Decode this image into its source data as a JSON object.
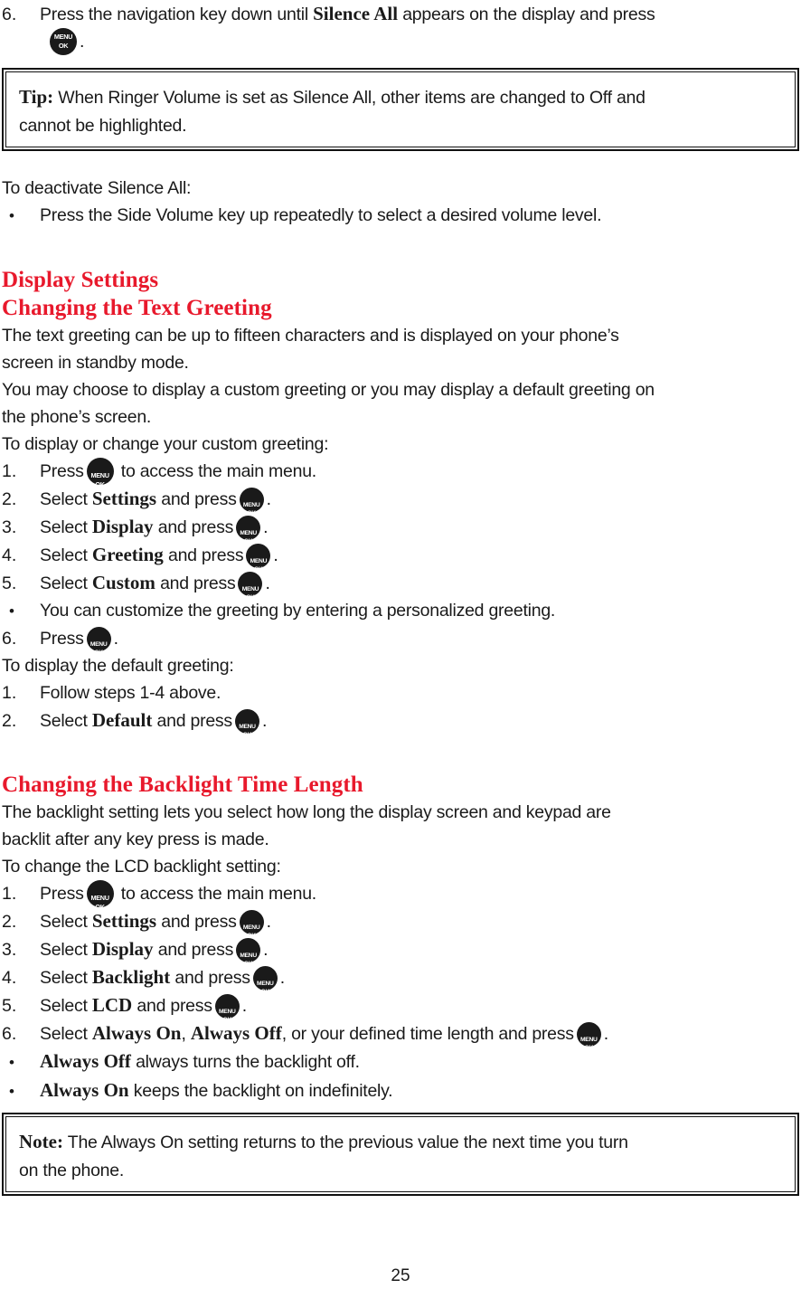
{
  "page": {
    "number": "25",
    "accent_color": "#e8192c",
    "text_color": "#1a1a1a"
  },
  "key_icon": {
    "name": "menu-ok-key",
    "line1": "MENU",
    "line2": "OK"
  },
  "silence_all_step": {
    "marker": "6.",
    "text_before_bold": "Press the navigation key down until ",
    "bold": "Silence All",
    "text_after_bold": " appears on the display and press",
    "continuation_suffix": "."
  },
  "tip_box": {
    "label": "Tip:",
    "line1": " When Ringer Volume is set as Silence All, other items are changed to Off and",
    "line2": "cannot be highlighted."
  },
  "deactivate": {
    "intro": "To deactivate Silence All:",
    "bullet_marker": "•",
    "bullet_text": "Press the Side Volume key up repeatedly to select a desired volume level."
  },
  "display_settings": {
    "section_heading": "Display Settings",
    "sub_heading": "Changing the Text Greeting",
    "paragraph_line1": "The text greeting can be up to fifteen characters and is displayed on your phone’s",
    "paragraph_line2": "screen in standby mode.",
    "paragraph_line3": "You may choose to display a custom greeting or you may display a default greeting on",
    "paragraph_line4": "the phone’s screen.",
    "custom_intro": "To display or change your custom greeting:",
    "steps": [
      {
        "marker": "1.",
        "pre": "Press",
        "bold": "",
        "post": "to access the main menu.",
        "key": "after-pre"
      },
      {
        "marker": "2.",
        "pre": "Select",
        "bold": "Settings",
        "post": "and press",
        "key": "end",
        "period": "."
      },
      {
        "marker": "3.",
        "pre": "Select",
        "bold": "Display",
        "post": "and press",
        "key": "end",
        "period": "."
      },
      {
        "marker": "4.",
        "pre": "Select",
        "bold": "Greeting",
        "post": "and press",
        "key": "end",
        "period": "."
      },
      {
        "marker": "5.",
        "pre": "Select",
        "bold": "Custom",
        "post": "and press",
        "key": "end",
        "period": "."
      }
    ],
    "customize_bullet_marker": "•",
    "customize_bullet_text": "You can customize the greeting by entering a personalized greeting.",
    "step6": {
      "marker": "6.",
      "pre": "Press",
      "period": "."
    },
    "default_intro": "To display the default greeting:",
    "default_steps": [
      {
        "marker": "1.",
        "text": "Follow steps 1-4 above."
      },
      {
        "marker": "2.",
        "pre": "Select",
        "bold": "Default",
        "post": "and press",
        "period": "."
      }
    ]
  },
  "backlight": {
    "sub_heading": "Changing the Backlight Time Length",
    "paragraph_line1": "The backlight setting lets you select how long the display screen and keypad are",
    "paragraph_line2": "backlit after any key press is made.",
    "intro": "To change the LCD backlight setting:",
    "steps": [
      {
        "marker": "1.",
        "pre": "Press",
        "bold": "",
        "post": "to access the main menu."
      },
      {
        "marker": "2.",
        "pre": "Select",
        "bold": "Settings",
        "post": "and press",
        "period": "."
      },
      {
        "marker": "3.",
        "pre": "Select",
        "bold": "Display",
        "post": "and press",
        "period": "."
      },
      {
        "marker": "4.",
        "pre": "Select",
        "bold": "Backlight",
        "post": "and press",
        "period": "."
      },
      {
        "marker": "5.",
        "pre": "Select",
        "bold": "LCD",
        "post": "and press",
        "period": "."
      }
    ],
    "step6": {
      "marker": "6.",
      "pre": "Select",
      "bold1": "Always On",
      "comma1": ", ",
      "bold2": "Always Off",
      "post": ", or your defined time length and press",
      "period": "."
    },
    "bullets": [
      {
        "marker": "•",
        "bold": "Always Off",
        "text": " always turns the backlight off."
      },
      {
        "marker": "•",
        "bold": "Always On",
        "text": " keeps the backlight on indefinitely."
      }
    ]
  },
  "note_box": {
    "label": "Note:",
    "line1": " The Always On setting returns to the previous value the next time you turn",
    "line2": "on the phone."
  }
}
